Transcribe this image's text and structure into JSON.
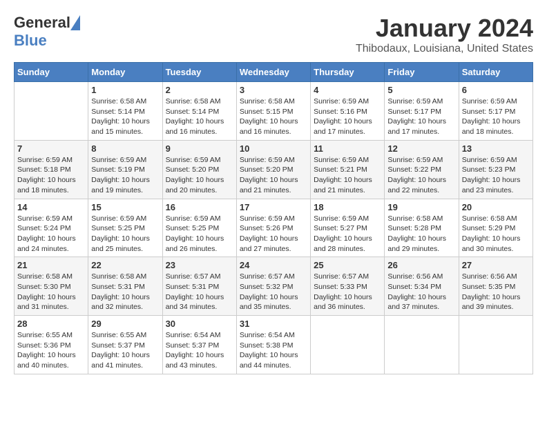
{
  "header": {
    "logo_general": "General",
    "logo_blue": "Blue",
    "month_title": "January 2024",
    "location": "Thibodaux, Louisiana, United States"
  },
  "calendar": {
    "days_of_week": [
      "Sunday",
      "Monday",
      "Tuesday",
      "Wednesday",
      "Thursday",
      "Friday",
      "Saturday"
    ],
    "weeks": [
      [
        {
          "day": "",
          "info": ""
        },
        {
          "day": "1",
          "info": "Sunrise: 6:58 AM\nSunset: 5:14 PM\nDaylight: 10 hours\nand 15 minutes."
        },
        {
          "day": "2",
          "info": "Sunrise: 6:58 AM\nSunset: 5:14 PM\nDaylight: 10 hours\nand 16 minutes."
        },
        {
          "day": "3",
          "info": "Sunrise: 6:58 AM\nSunset: 5:15 PM\nDaylight: 10 hours\nand 16 minutes."
        },
        {
          "day": "4",
          "info": "Sunrise: 6:59 AM\nSunset: 5:16 PM\nDaylight: 10 hours\nand 17 minutes."
        },
        {
          "day": "5",
          "info": "Sunrise: 6:59 AM\nSunset: 5:17 PM\nDaylight: 10 hours\nand 17 minutes."
        },
        {
          "day": "6",
          "info": "Sunrise: 6:59 AM\nSunset: 5:17 PM\nDaylight: 10 hours\nand 18 minutes."
        }
      ],
      [
        {
          "day": "7",
          "info": ""
        },
        {
          "day": "8",
          "info": "Sunrise: 6:59 AM\nSunset: 5:19 PM\nDaylight: 10 hours\nand 19 minutes."
        },
        {
          "day": "9",
          "info": "Sunrise: 6:59 AM\nSunset: 5:20 PM\nDaylight: 10 hours\nand 20 minutes."
        },
        {
          "day": "10",
          "info": "Sunrise: 6:59 AM\nSunset: 5:20 PM\nDaylight: 10 hours\nand 21 minutes."
        },
        {
          "day": "11",
          "info": "Sunrise: 6:59 AM\nSunset: 5:21 PM\nDaylight: 10 hours\nand 21 minutes."
        },
        {
          "day": "12",
          "info": "Sunrise: 6:59 AM\nSunset: 5:22 PM\nDaylight: 10 hours\nand 22 minutes."
        },
        {
          "day": "13",
          "info": "Sunrise: 6:59 AM\nSunset: 5:23 PM\nDaylight: 10 hours\nand 23 minutes."
        }
      ],
      [
        {
          "day": "14",
          "info": ""
        },
        {
          "day": "15",
          "info": "Sunrise: 6:59 AM\nSunset: 5:25 PM\nDaylight: 10 hours\nand 25 minutes."
        },
        {
          "day": "16",
          "info": "Sunrise: 6:59 AM\nSunset: 5:25 PM\nDaylight: 10 hours\nand 26 minutes."
        },
        {
          "day": "17",
          "info": "Sunrise: 6:59 AM\nSunset: 5:26 PM\nDaylight: 10 hours\nand 27 minutes."
        },
        {
          "day": "18",
          "info": "Sunrise: 6:59 AM\nSunset: 5:27 PM\nDaylight: 10 hours\nand 28 minutes."
        },
        {
          "day": "19",
          "info": "Sunrise: 6:58 AM\nSunset: 5:28 PM\nDaylight: 10 hours\nand 29 minutes."
        },
        {
          "day": "20",
          "info": "Sunrise: 6:58 AM\nSunset: 5:29 PM\nDaylight: 10 hours\nand 30 minutes."
        }
      ],
      [
        {
          "day": "21",
          "info": ""
        },
        {
          "day": "22",
          "info": "Sunrise: 6:58 AM\nSunset: 5:31 PM\nDaylight: 10 hours\nand 32 minutes."
        },
        {
          "day": "23",
          "info": "Sunrise: 6:57 AM\nSunset: 5:31 PM\nDaylight: 10 hours\nand 34 minutes."
        },
        {
          "day": "24",
          "info": "Sunrise: 6:57 AM\nSunset: 5:32 PM\nDaylight: 10 hours\nand 35 minutes."
        },
        {
          "day": "25",
          "info": "Sunrise: 6:57 AM\nSunset: 5:33 PM\nDaylight: 10 hours\nand 36 minutes."
        },
        {
          "day": "26",
          "info": "Sunrise: 6:56 AM\nSunset: 5:34 PM\nDaylight: 10 hours\nand 37 minutes."
        },
        {
          "day": "27",
          "info": "Sunrise: 6:56 AM\nSunset: 5:35 PM\nDaylight: 10 hours\nand 39 minutes."
        }
      ],
      [
        {
          "day": "28",
          "info": ""
        },
        {
          "day": "29",
          "info": "Sunrise: 6:55 AM\nSunset: 5:37 PM\nDaylight: 10 hours\nand 41 minutes."
        },
        {
          "day": "30",
          "info": "Sunrise: 6:54 AM\nSunset: 5:37 PM\nDaylight: 10 hours\nand 43 minutes."
        },
        {
          "day": "31",
          "info": "Sunrise: 6:54 AM\nSunset: 5:38 PM\nDaylight: 10 hours\nand 44 minutes."
        },
        {
          "day": "",
          "info": ""
        },
        {
          "day": "",
          "info": ""
        },
        {
          "day": "",
          "info": ""
        }
      ]
    ],
    "week0_day7_info": "Sunrise: 6:59 AM\nSunset: 5:18 PM\nDaylight: 10 hours\nand 18 minutes.",
    "week2_day14_info": "Sunrise: 6:59 AM\nSunset: 5:24 PM\nDaylight: 10 hours\nand 24 minutes.",
    "week3_day21_info": "Sunrise: 6:58 AM\nSunset: 5:30 PM\nDaylight: 10 hours\nand 31 minutes.",
    "week4_day28_info": "Sunrise: 6:55 AM\nSunset: 5:36 PM\nDaylight: 10 hours\nand 40 minutes."
  }
}
